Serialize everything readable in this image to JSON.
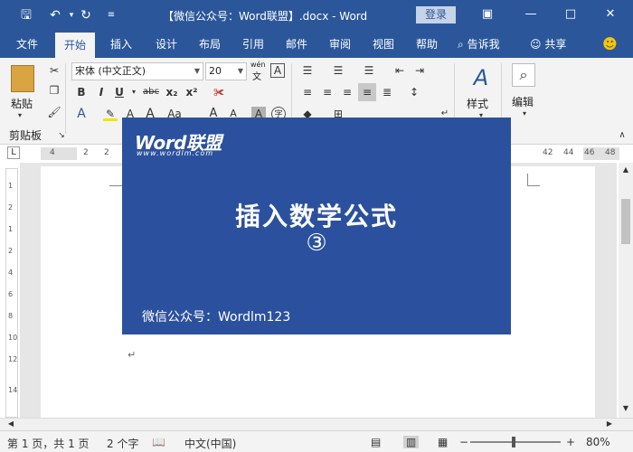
{
  "titlebar": {
    "title": "【微信公众号：Word联盟】.docx  -  Word",
    "login": "登录",
    "save_icon": "save-icon",
    "undo_icon": "undo-icon",
    "redo_icon": "redo-icon"
  },
  "tabs": [
    {
      "label": "文件"
    },
    {
      "label": "开始"
    },
    {
      "label": "插入"
    },
    {
      "label": "设计"
    },
    {
      "label": "布局"
    },
    {
      "label": "引用"
    },
    {
      "label": "邮件"
    },
    {
      "label": "审阅"
    },
    {
      "label": "视图"
    },
    {
      "label": "帮助"
    }
  ],
  "tell_me": "告诉我",
  "share": "共享",
  "ribbon": {
    "paste": "粘贴",
    "font_name": "宋体 (中文正文)",
    "font_size": "20",
    "wen": "wén",
    "wen2": "文",
    "styles": "样式",
    "edit": "编辑",
    "clipboard": "剪贴板"
  },
  "ruler": {
    "h_ticks": [
      "4",
      "2",
      "2",
      "42",
      "44",
      "46",
      "48"
    ],
    "v_ticks": [
      "1",
      "2",
      "1",
      "2",
      "4",
      "6",
      "8",
      "10",
      "12",
      "14"
    ]
  },
  "banner": {
    "brand": "Word联盟",
    "brand_url": "www.wordlm.com",
    "title": "插入数学公式",
    "number": "③",
    "footer": "微信公众号：Wordlm123"
  },
  "status": {
    "page": "第 1 页，共 1 页",
    "words": "2 个字",
    "language": "中文(中国)",
    "zoom": "80%"
  }
}
